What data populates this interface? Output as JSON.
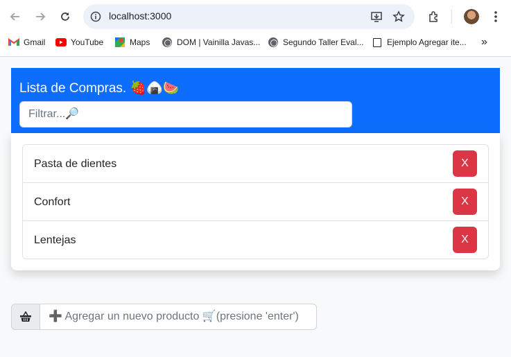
{
  "browser": {
    "url": "localhost:3000",
    "bookmarks": [
      {
        "label": "Gmail",
        "icon": "gmail-icon"
      },
      {
        "label": "YouTube",
        "icon": "youtube-icon"
      },
      {
        "label": "Maps",
        "icon": "maps-icon"
      },
      {
        "label": "DOM | Vainilla Javas...",
        "icon": "globe-icon"
      },
      {
        "label": "Segundo Taller Eval...",
        "icon": "globe-icon"
      },
      {
        "label": "Ejemplo Agregar ite...",
        "icon": "document-icon"
      }
    ],
    "more_bookmarks": "»"
  },
  "app": {
    "title": "Lista de Compras. 🍓🍙🍉",
    "filter_placeholder": "Filtrar...🔎",
    "items": [
      {
        "label": "Pasta de dientes",
        "delete_label": "X"
      },
      {
        "label": "Confort",
        "delete_label": "X"
      },
      {
        "label": "Lentejas",
        "delete_label": "X"
      }
    ],
    "add_placeholder": "➕ Agregar un nuevo producto 🛒(presione 'enter')",
    "colors": {
      "header": "#0d6efd",
      "delete": "#dc3545"
    }
  }
}
